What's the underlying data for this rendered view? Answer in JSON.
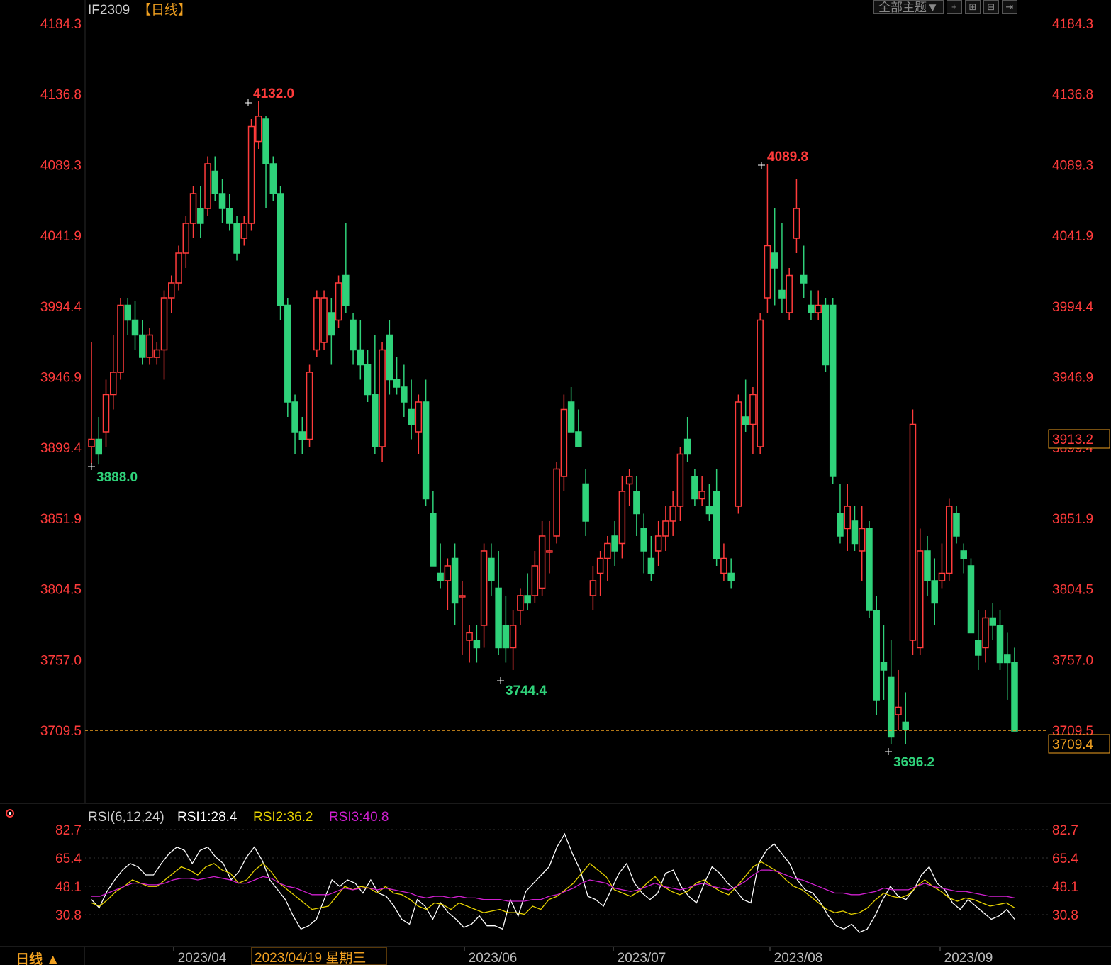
{
  "header": {
    "symbol": "IF2309",
    "period_tag": "【日线】",
    "theme_button": "全部主题▼"
  },
  "colors": {
    "up": "#ff3b3b",
    "down": "#2fd27a",
    "axis_label": "#ff3b3b",
    "grid": "#2a2a2a",
    "last_price": "#f0a020",
    "rsi1": "#ffffff",
    "rsi2": "#e6d200",
    "rsi3": "#d020d0"
  },
  "rsi_legend": {
    "title": "RSI(6,12,24)",
    "rsi1": "RSI1:28.4",
    "rsi2": "RSI2:36.2",
    "rsi3": "RSI3:40.8"
  },
  "footer": {
    "period_button": "日线 ▲",
    "cursor_date": "2023/04/19 星期三"
  },
  "chart_data": [
    {
      "type": "candlestick",
      "y_ticks": [
        "4184.3",
        "4136.8",
        "4089.3",
        "4041.9",
        "3994.4",
        "3946.9",
        "3899.4",
        "3851.9",
        "3804.5",
        "3757.0",
        "3709.5"
      ],
      "ylim": [
        3670,
        4184.3
      ],
      "x_ticks": [
        "2023/04",
        "2023/06",
        "2023/07",
        "2023/08",
        "2023/09"
      ],
      "markers": {
        "high1": "4132.0",
        "high2": "4089.8",
        "low1": "3888.0",
        "low2": "3744.4",
        "low3": "3696.2"
      },
      "right_labels": {
        "current": "3913.2",
        "last": "3709.4"
      },
      "last_price": 3709.4,
      "candles": [
        [
          3900,
          3970,
          3888,
          3905
        ],
        [
          3905,
          3920,
          3888,
          3895
        ],
        [
          3910,
          3945,
          3900,
          3935
        ],
        [
          3935,
          3975,
          3925,
          3950
        ],
        [
          3950,
          4000,
          3945,
          3995
        ],
        [
          3995,
          4000,
          3975,
          3985
        ],
        [
          3985,
          3998,
          3965,
          3975
        ],
        [
          3975,
          3985,
          3955,
          3960
        ],
        [
          3960,
          3980,
          3955,
          3975
        ],
        [
          3960,
          3970,
          3955,
          3965
        ],
        [
          3965,
          4005,
          3945,
          4000
        ],
        [
          4000,
          4015,
          3990,
          4010
        ],
        [
          4010,
          4035,
          4005,
          4030
        ],
        [
          4030,
          4055,
          4020,
          4050
        ],
        [
          4050,
          4075,
          4040,
          4070
        ],
        [
          4060,
          4075,
          4040,
          4050
        ],
        [
          4060,
          4095,
          4055,
          4090
        ],
        [
          4085,
          4095,
          4065,
          4070
        ],
        [
          4070,
          4080,
          4050,
          4060
        ],
        [
          4060,
          4070,
          4045,
          4050
        ],
        [
          4050,
          4055,
          4025,
          4030
        ],
        [
          4040,
          4055,
          4035,
          4050
        ],
        [
          4050,
          4120,
          4045,
          4115
        ],
        [
          4105,
          4132,
          4100,
          4122
        ],
        [
          4120,
          4122,
          4060,
          4090
        ],
        [
          4090,
          4095,
          4065,
          4070
        ],
        [
          4070,
          4075,
          3985,
          3995
        ],
        [
          3995,
          4000,
          3920,
          3930
        ],
        [
          3930,
          3935,
          3895,
          3910
        ],
        [
          3910,
          3920,
          3895,
          3905
        ],
        [
          3905,
          3955,
          3900,
          3950
        ],
        [
          3965,
          4005,
          3960,
          4000
        ],
        [
          3970,
          4005,
          3965,
          4000
        ],
        [
          3990,
          4000,
          3955,
          3975
        ],
        [
          3985,
          4015,
          3980,
          4010
        ],
        [
          4015,
          4050,
          3990,
          3995
        ],
        [
          3985,
          3990,
          3955,
          3965
        ],
        [
          3965,
          3985,
          3945,
          3955
        ],
        [
          3955,
          3965,
          3930,
          3935
        ],
        [
          3935,
          3975,
          3895,
          3900
        ],
        [
          3900,
          3970,
          3890,
          3965
        ],
        [
          3975,
          3985,
          3935,
          3945
        ],
        [
          3945,
          3960,
          3935,
          3940
        ],
        [
          3940,
          3955,
          3920,
          3930
        ],
        [
          3925,
          3945,
          3905,
          3915
        ],
        [
          3910,
          3935,
          3895,
          3930
        ],
        [
          3930,
          3945,
          3860,
          3865
        ],
        [
          3855,
          3870,
          3820,
          3820
        ],
        [
          3815,
          3835,
          3805,
          3810
        ],
        [
          3810,
          3825,
          3790,
          3820
        ],
        [
          3825,
          3835,
          3780,
          3795
        ],
        [
          3800,
          3810,
          3760,
          3800
        ],
        [
          3770,
          3780,
          3755,
          3775
        ],
        [
          3770,
          3780,
          3755,
          3765
        ],
        [
          3780,
          3835,
          3765,
          3830
        ],
        [
          3825,
          3835,
          3800,
          3810
        ],
        [
          3805,
          3830,
          3760,
          3765
        ],
        [
          3780,
          3800,
          3755,
          3765
        ],
        [
          3765,
          3790,
          3750,
          3780
        ],
        [
          3790,
          3805,
          3780,
          3800
        ],
        [
          3800,
          3815,
          3790,
          3795
        ],
        [
          3800,
          3830,
          3795,
          3820
        ],
        [
          3805,
          3850,
          3800,
          3840
        ],
        [
          3830,
          3850,
          3815,
          3830
        ],
        [
          3840,
          3890,
          3835,
          3885
        ],
        [
          3880,
          3935,
          3870,
          3925
        ],
        [
          3930,
          3940,
          3910,
          3910
        ],
        [
          3910,
          3925,
          3900,
          3900
        ],
        [
          3875,
          3885,
          3840,
          3850
        ],
        [
          3800,
          3820,
          3790,
          3810
        ],
        [
          3815,
          3830,
          3800,
          3825
        ],
        [
          3825,
          3840,
          3810,
          3835
        ],
        [
          3840,
          3850,
          3820,
          3830
        ],
        [
          3835,
          3880,
          3825,
          3870
        ],
        [
          3875,
          3885,
          3860,
          3880
        ],
        [
          3870,
          3880,
          3840,
          3855
        ],
        [
          3845,
          3855,
          3815,
          3830
        ],
        [
          3825,
          3840,
          3810,
          3815
        ],
        [
          3830,
          3850,
          3820,
          3840
        ],
        [
          3840,
          3860,
          3830,
          3850
        ],
        [
          3850,
          3870,
          3840,
          3860
        ],
        [
          3860,
          3900,
          3850,
          3895
        ],
        [
          3905,
          3920,
          3890,
          3895
        ],
        [
          3880,
          3885,
          3860,
          3865
        ],
        [
          3865,
          3880,
          3860,
          3870
        ],
        [
          3860,
          3875,
          3850,
          3855
        ],
        [
          3870,
          3885,
          3820,
          3825
        ],
        [
          3815,
          3835,
          3810,
          3825
        ],
        [
          3815,
          3825,
          3805,
          3810
        ],
        [
          3860,
          3935,
          3855,
          3930
        ],
        [
          3920,
          3945,
          3910,
          3915
        ],
        [
          3915,
          3940,
          3895,
          3935
        ],
        [
          3900,
          3990,
          3895,
          3985
        ],
        [
          4000,
          4090,
          3990,
          4035
        ],
        [
          4030,
          4060,
          3995,
          4020
        ],
        [
          4005,
          4050,
          3990,
          4000
        ],
        [
          3990,
          4020,
          3985,
          4015
        ],
        [
          4040,
          4080,
          4030,
          4060
        ],
        [
          4015,
          4035,
          4000,
          4010
        ],
        [
          3995,
          4005,
          3985,
          3990
        ],
        [
          3990,
          4005,
          3985,
          3995
        ],
        [
          3995,
          4000,
          3950,
          3955
        ],
        [
          3995,
          4000,
          3875,
          3880
        ],
        [
          3855,
          3875,
          3835,
          3840
        ],
        [
          3845,
          3875,
          3830,
          3860
        ],
        [
          3850,
          3860,
          3830,
          3835
        ],
        [
          3830,
          3860,
          3810,
          3845
        ],
        [
          3845,
          3850,
          3785,
          3790
        ],
        [
          3790,
          3800,
          3720,
          3730
        ],
        [
          3755,
          3780,
          3730,
          3750
        ],
        [
          3745,
          3770,
          3700,
          3705
        ],
        [
          3720,
          3750,
          3710,
          3725
        ],
        [
          3715,
          3735,
          3700,
          3710
        ],
        [
          3770,
          3925,
          3760,
          3915
        ],
        [
          3765,
          3845,
          3760,
          3830
        ],
        [
          3830,
          3840,
          3800,
          3810
        ],
        [
          3810,
          3825,
          3780,
          3795
        ],
        [
          3810,
          3835,
          3805,
          3815
        ],
        [
          3815,
          3865,
          3810,
          3860
        ],
        [
          3855,
          3860,
          3835,
          3840
        ],
        [
          3830,
          3835,
          3815,
          3825
        ],
        [
          3820,
          3825,
          3785,
          3775
        ],
        [
          3770,
          3790,
          3750,
          3760
        ],
        [
          3765,
          3790,
          3755,
          3785
        ],
        [
          3785,
          3795,
          3770,
          3780
        ],
        [
          3780,
          3790,
          3750,
          3755
        ],
        [
          3760,
          3775,
          3730,
          3755
        ],
        [
          3755,
          3765,
          3709,
          3709
        ]
      ]
    },
    {
      "type": "line",
      "title": "RSI(6,12,24)",
      "y_ticks": [
        "82.7",
        "65.4",
        "48.1",
        "30.8"
      ],
      "ylim": [
        18,
        84
      ],
      "series": [
        {
          "name": "RSI1",
          "values": [
            40,
            35,
            45,
            52,
            58,
            62,
            60,
            55,
            55,
            62,
            68,
            72,
            70,
            62,
            70,
            72,
            66,
            62,
            52,
            57,
            66,
            72,
            64,
            52,
            46,
            40,
            30,
            22,
            24,
            28,
            40,
            52,
            48,
            52,
            50,
            44,
            52,
            44,
            42,
            36,
            28,
            25,
            40,
            36,
            28,
            38,
            32,
            28,
            23,
            25,
            30,
            24,
            24,
            22,
            40,
            30,
            45,
            50,
            55,
            60,
            72,
            80,
            68,
            58,
            42,
            40,
            36,
            46,
            56,
            62,
            50,
            44,
            40,
            44,
            56,
            58,
            48,
            42,
            38,
            50,
            60,
            56,
            50,
            46,
            40,
            38,
            62,
            70,
            74,
            68,
            62,
            52,
            46,
            44,
            38,
            30,
            24,
            22,
            25,
            20,
            22,
            30,
            40,
            48,
            42,
            40,
            46,
            55,
            60,
            50,
            46,
            38,
            34,
            40,
            36,
            32,
            28,
            30,
            34,
            28
          ]
        },
        {
          "name": "RSI2",
          "values": [
            38,
            36,
            40,
            45,
            48,
            52,
            50,
            48,
            48,
            52,
            56,
            60,
            58,
            55,
            60,
            62,
            58,
            56,
            50,
            52,
            58,
            62,
            57,
            50,
            46,
            42,
            38,
            34,
            35,
            36,
            42,
            48,
            46,
            48,
            47,
            44,
            48,
            44,
            43,
            40,
            36,
            34,
            38,
            37,
            34,
            38,
            36,
            34,
            32,
            33,
            34,
            32,
            32,
            31,
            36,
            34,
            40,
            42,
            46,
            50,
            56,
            62,
            58,
            54,
            46,
            44,
            42,
            45,
            50,
            54,
            48,
            45,
            43,
            45,
            50,
            52,
            48,
            45,
            43,
            48,
            54,
            60,
            63,
            60,
            57,
            52,
            48,
            46,
            42,
            38,
            34,
            32,
            33,
            31,
            32,
            35,
            40,
            44,
            42,
            41,
            43,
            48,
            52,
            48,
            45,
            41,
            39,
            41,
            40,
            38,
            36,
            37,
            38,
            35
          ]
        },
        {
          "name": "RSI3",
          "values": [
            42,
            42,
            44,
            46,
            48,
            50,
            50,
            49,
            49,
            50,
            52,
            53,
            53,
            52,
            53,
            54,
            53,
            52,
            50,
            50,
            52,
            54,
            53,
            50,
            48,
            47,
            45,
            43,
            43,
            43,
            45,
            47,
            46,
            47,
            47,
            46,
            47,
            46,
            45,
            44,
            42,
            41,
            42,
            42,
            41,
            42,
            41,
            41,
            40,
            40,
            40,
            39,
            39,
            39,
            40,
            40,
            42,
            43,
            45,
            47,
            50,
            52,
            51,
            50,
            47,
            46,
            45,
            46,
            48,
            50,
            48,
            47,
            46,
            47,
            49,
            50,
            48,
            47,
            46,
            48,
            51,
            55,
            58,
            58,
            57,
            55,
            53,
            52,
            50,
            48,
            46,
            44,
            44,
            43,
            43,
            44,
            45,
            47,
            46,
            46,
            46,
            48,
            50,
            48,
            47,
            46,
            45,
            45,
            44,
            43,
            42,
            42,
            42,
            41
          ]
        }
      ]
    }
  ]
}
